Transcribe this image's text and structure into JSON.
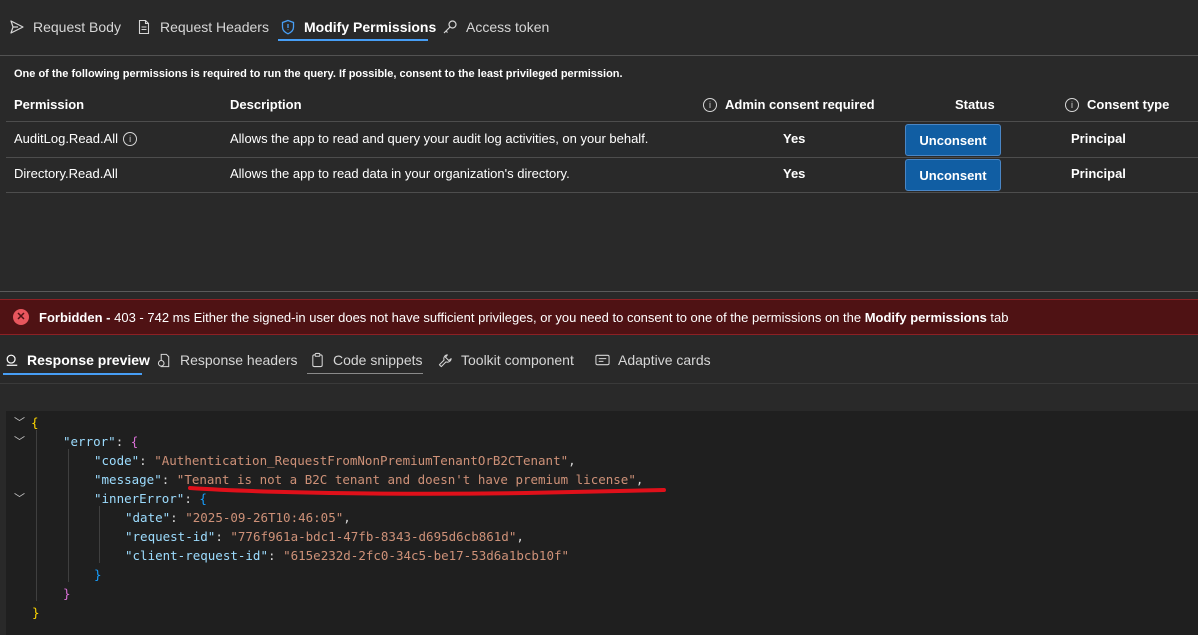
{
  "request_tabs": [
    {
      "label": "Request Body",
      "icon": "send-icon"
    },
    {
      "label": "Request Headers",
      "icon": "document-icon"
    },
    {
      "label": "Modify Permissions",
      "icon": "shield-icon",
      "active": true
    },
    {
      "label": "Access token",
      "icon": "key-icon"
    }
  ],
  "permissions": {
    "note": "One of the following permissions is required to run the query. If possible, consent to the least privileged permission.",
    "columns": {
      "permission": "Permission",
      "description": "Description",
      "admin_consent": "Admin consent required",
      "status": "Status",
      "consent_type": "Consent type"
    },
    "info_glyph": "i",
    "rows": [
      {
        "permission": "AuditLog.Read.All",
        "description": "Allows the app to read and query your audit log activities, on your behalf.",
        "admin_consent": "Yes",
        "status_button": "Unconsent",
        "consent_type": "Principal"
      },
      {
        "permission": "Directory.Read.All",
        "description": "Allows the app to read data in your organization's directory.",
        "admin_consent": "Yes",
        "status_button": "Unconsent",
        "consent_type": "Principal"
      }
    ]
  },
  "error_bar": {
    "status": "Forbidden -",
    "details": " 403 - 742 ms Either the signed-in user does not have sufficient privileges, or you need to consent to one of the permissions on the ",
    "tab_name": "Modify permissions",
    "suffix": " tab",
    "icon": "error-circle-icon",
    "color": "#4f1214"
  },
  "response_tabs": [
    {
      "label": "Response preview",
      "icon": "preview-icon",
      "active": true
    },
    {
      "label": "Response headers",
      "icon": "headers-icon"
    },
    {
      "label": "Code snippets",
      "icon": "clipboard-icon"
    },
    {
      "label": "Toolkit component",
      "icon": "toolkit-icon"
    },
    {
      "label": "Adaptive cards",
      "icon": "card-icon"
    }
  ],
  "response_json": {
    "error_key": "\"error\"",
    "code_key": "\"code\"",
    "code_value": "\"Authentication_RequestFromNonPremiumTenantOrB2CTenant\"",
    "message_key": "\"message\"",
    "message_value": "\"Tenant is not a B2C tenant and doesn't have premium license\"",
    "inner_key": "\"innerError\"",
    "date_key": "\"date\"",
    "date_value": "\"2025-09-26T10:46:05\"",
    "request_id_key": "\"request-id\"",
    "request_id_value": "\"776f961a-bdc1-47fb-8343-d695d6cb861d\"",
    "client_request_id_key": "\"client-request-id\"",
    "client_request_id_value": "\"615e232d-2fc0-34c5-be17-53d6a1bcb10f\""
  },
  "colors": {
    "accent": "#479ef5",
    "button": "#115ea3",
    "annotation": "#e0101a"
  }
}
